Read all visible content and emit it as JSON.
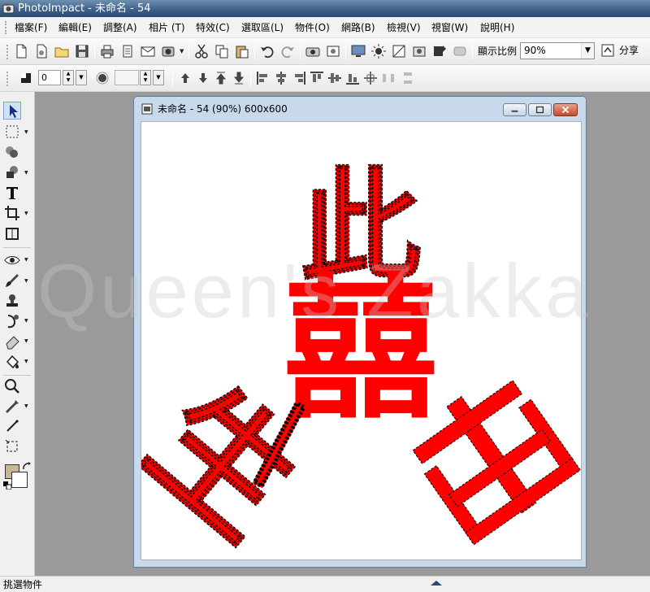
{
  "window": {
    "title": "PhotoImpact - 未命名 - 54"
  },
  "menu": {
    "items": [
      "檔案(F)",
      "編輯(E)",
      "調整(A)",
      "相片 (T)",
      "特效(C)",
      "選取區(L)",
      "物件(O)",
      "網路(B)",
      "檢視(V)",
      "視窗(W)",
      "說明(H)"
    ]
  },
  "toolbar": {
    "zoom_label": "顯示比例",
    "zoom_value": "90%",
    "share_label": "分享"
  },
  "attribute_bar": {
    "value_field": "0"
  },
  "document": {
    "title": "未命名 - 54 (90%) 600x600",
    "canvas_text": [
      "此",
      "囍",
      "生",
      "一"
    ]
  },
  "watermark": "Queen's Zakka",
  "statusbar": {
    "text": "挑選物件"
  },
  "colors": {
    "foreground": "#c8b594",
    "background": "#ffffff",
    "text_object": "#ff0000",
    "accent": "#3d5f86"
  }
}
